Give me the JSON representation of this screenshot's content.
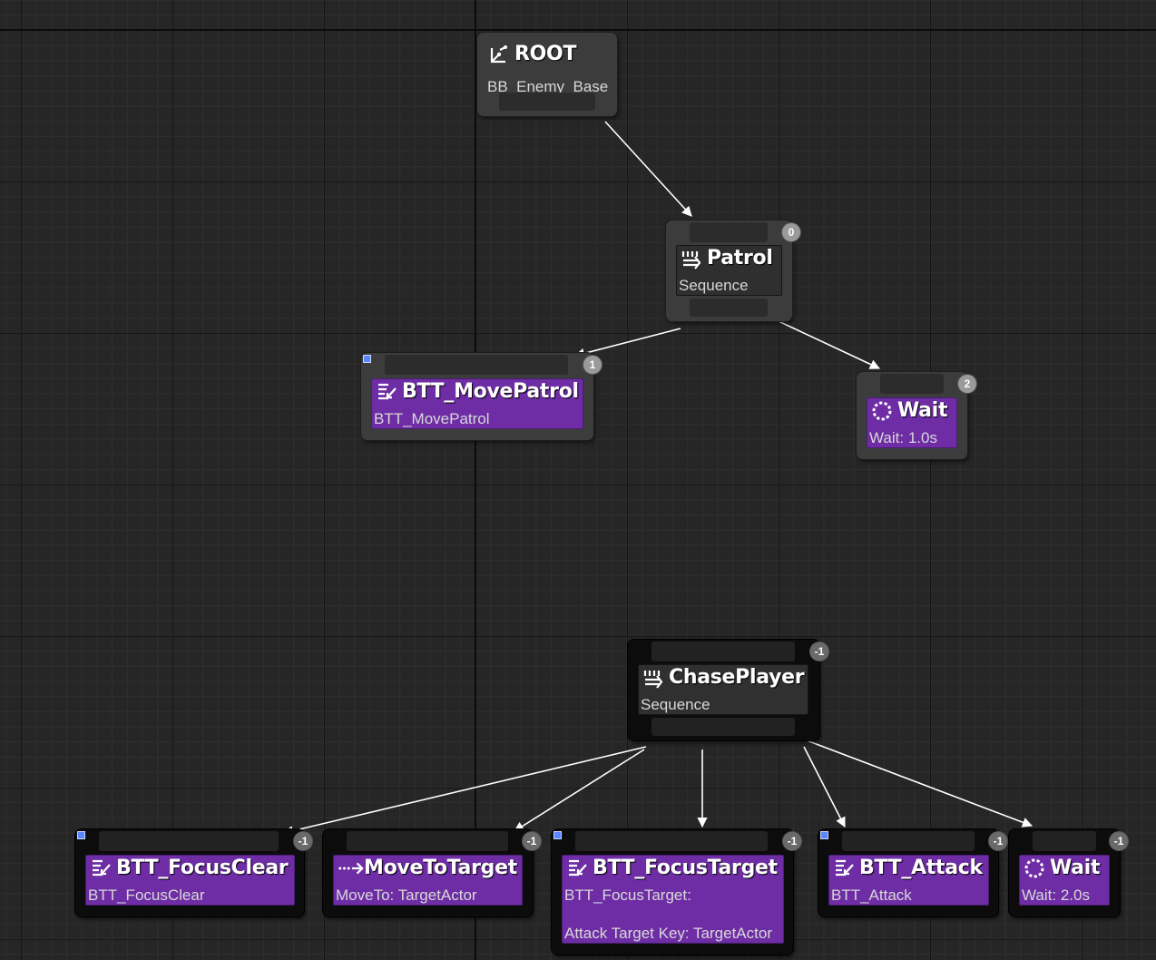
{
  "root": {
    "title": "ROOT",
    "subtitle": "BB_Enemy_Base",
    "icon": "root-icon"
  },
  "patrol": {
    "title": "Patrol",
    "subtitle": "Sequence",
    "index": "0",
    "icon": "sequence-icon"
  },
  "move_patrol": {
    "title": "BTT_MovePatrol",
    "subtitle": "BTT_MovePatrol",
    "index": "1",
    "icon": "blueprint-task-icon"
  },
  "wait_1": {
    "title": "Wait",
    "subtitle": "Wait: 1.0s",
    "index": "2",
    "icon": "wait-icon"
  },
  "chase": {
    "title": "ChasePlayer",
    "subtitle": "Sequence",
    "index": "-1",
    "icon": "sequence-icon"
  },
  "focus_clear": {
    "title": "BTT_FocusClear",
    "subtitle": "BTT_FocusClear",
    "index": "-1",
    "icon": "blueprint-task-icon"
  },
  "move_to": {
    "title": "MoveToTarget",
    "subtitle": "MoveTo: TargetActor",
    "index": "-1",
    "icon": "move-to-icon"
  },
  "focus_target": {
    "title": "BTT_FocusTarget",
    "subtitle": "BTT_FocusTarget:",
    "detail": "Attack Target Key: TargetActor",
    "index": "-1",
    "icon": "blueprint-task-icon"
  },
  "attack": {
    "title": "BTT_Attack",
    "subtitle": "BTT_Attack",
    "index": "-1",
    "icon": "blueprint-task-icon"
  },
  "wait_2": {
    "title": "Wait",
    "subtitle": "Wait: 2.0s",
    "index": "-1",
    "icon": "wait-icon"
  },
  "colors": {
    "task": "#6e2da5",
    "composite": "#2f2f2f",
    "background": "#262626",
    "badge": "#9a9a9a",
    "wire": "#ffffff"
  }
}
